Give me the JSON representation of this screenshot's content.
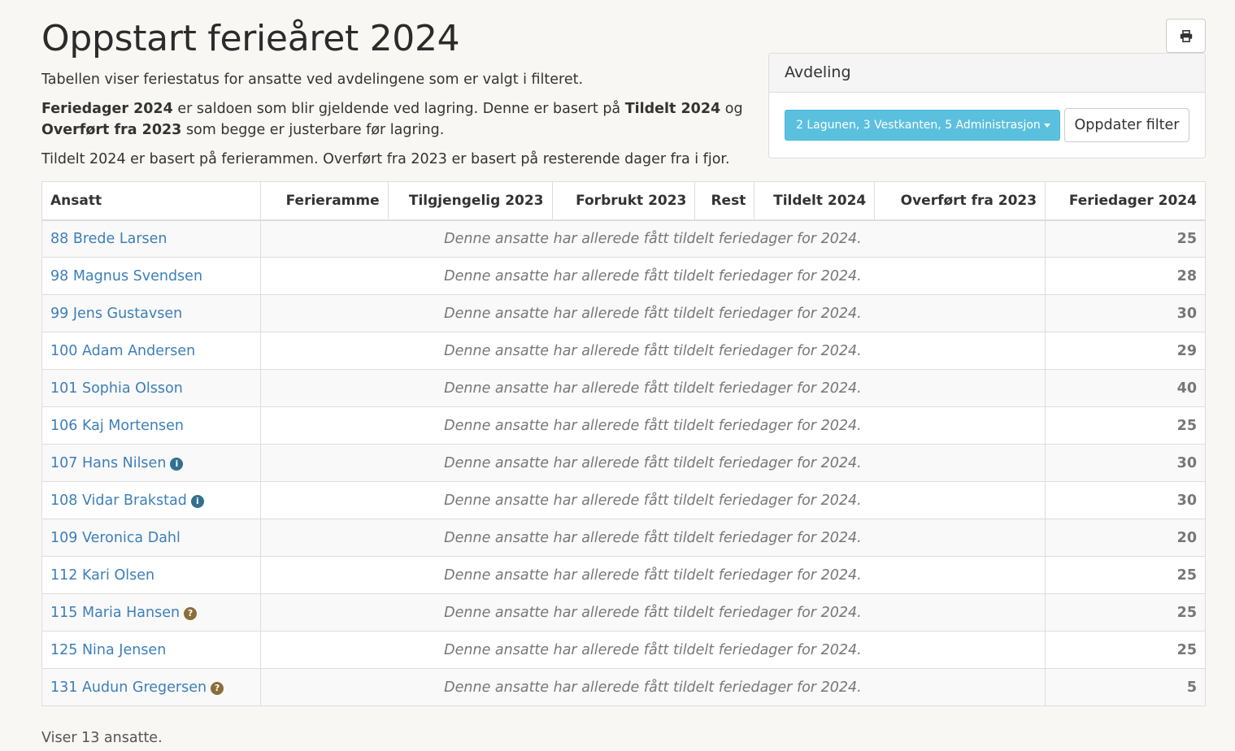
{
  "title": "Oppstart ferieåret 2024",
  "intro": {
    "line1": "Tabellen viser feriestatus for ansatte ved avdelingene som er valgt i filteret.",
    "p2_b1": "Feriedager 2024",
    "p2_t1": " er saldoen som blir gjeldende ved lagring. Denne er basert på ",
    "p2_b2": "Tildelt 2024",
    "p2_t2": " og ",
    "p2_b3": "Overført fra 2023",
    "p2_t3": " som begge er justerbare før lagring.",
    "line3": "Tildelt 2024 er basert på ferierammen. Overført fra 2023 er basert på resterende dager fra i fjor."
  },
  "toolbar": {
    "print_icon": "print-icon"
  },
  "filter": {
    "heading": "Avdeling",
    "selected": "2 Lagunen, 3 Vestkanten, 5 Administrasjon",
    "update_label": "Oppdater filter",
    "accent_color": "#5bc0de"
  },
  "table": {
    "columns": [
      "Ansatt",
      "Ferieramme",
      "Tilgjengelig 2023",
      "Forbrukt 2023",
      "Rest",
      "Tildelt 2024",
      "Overført fra 2023",
      "Feriedager 2024"
    ],
    "message": "Denne ansatte har allerede fått tildelt feriedager for 2024.",
    "rows": [
      {
        "name": "88 Brede Larsen",
        "days": "25",
        "icon": ""
      },
      {
        "name": "98 Magnus Svendsen",
        "days": "28",
        "icon": ""
      },
      {
        "name": "99 Jens Gustavsen",
        "days": "30",
        "icon": ""
      },
      {
        "name": "100 Adam Andersen",
        "days": "29",
        "icon": ""
      },
      {
        "name": "101 Sophia Olsson",
        "days": "40",
        "icon": ""
      },
      {
        "name": "106 Kaj Mortensen",
        "days": "25",
        "icon": ""
      },
      {
        "name": "107 Hans Nilsen",
        "days": "30",
        "icon": "info-icon"
      },
      {
        "name": "108 Vidar Brakstad",
        "days": "30",
        "icon": "info-icon"
      },
      {
        "name": "109 Veronica Dahl",
        "days": "20",
        "icon": ""
      },
      {
        "name": "112 Kari Olsen",
        "days": "25",
        "icon": ""
      },
      {
        "name": "115 Maria Hansen",
        "days": "25",
        "icon": "question-icon"
      },
      {
        "name": "125 Nina Jensen",
        "days": "25",
        "icon": ""
      },
      {
        "name": "131 Audun Gregersen",
        "days": "5",
        "icon": "question-icon"
      }
    ]
  },
  "footer": "Viser 13 ansatte."
}
